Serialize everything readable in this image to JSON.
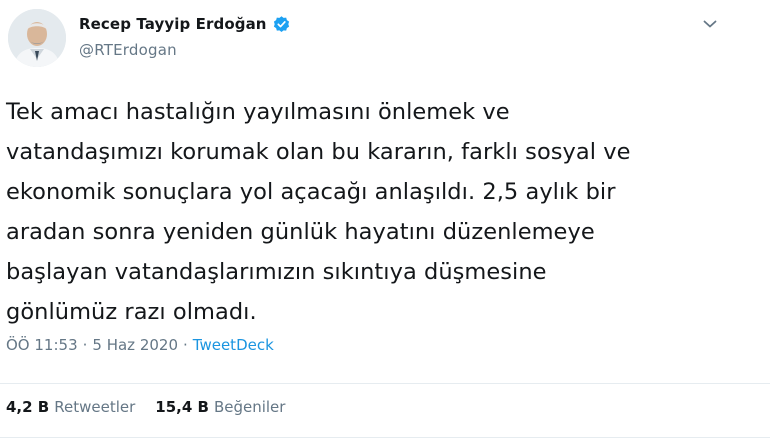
{
  "author": {
    "name": "Recep Tayyip Erdoğan",
    "handle": "@RTErdogan",
    "verified": true,
    "verified_color": "#1da1f2"
  },
  "tweet": {
    "text": "Tek amacı hastalığın yayılmasını önlemek ve\nvatandaşımızı korumak olan bu kararın, farklı sosyal ve\nekonomik sonuçlara yol açacağı anlaşıldı. 2,5 aylık bir\naradan sonra yeniden günlük hayatını düzenlemeye\nbaşlayan vatandaşlarımızın sıkıntıya düşmesine\ngönlümüz razı olmadı.",
    "time": "ÖÖ 11:53",
    "separator1": "·",
    "date": "5 Haz 2020",
    "separator2": "·",
    "source": "TweetDeck"
  },
  "stats": {
    "retweets_count": "4,2 B",
    "retweets_label": "Retweetler",
    "likes_count": "15,4 B",
    "likes_label": "Beğeniler"
  },
  "icons": {
    "caret": "chevron-down-icon",
    "verified": "verified-badge-icon"
  },
  "colors": {
    "text": "#14171a",
    "secondary": "#657786",
    "link": "#1b95e0",
    "divider": "#e6ecf0"
  }
}
